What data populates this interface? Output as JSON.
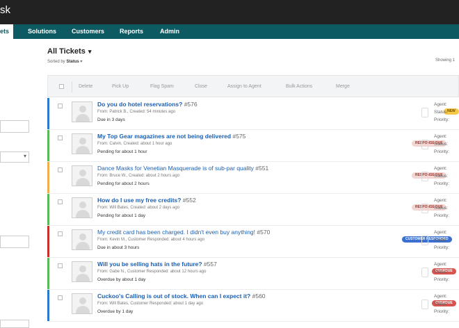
{
  "app": {
    "brand": "sk"
  },
  "nav": {
    "items": [
      {
        "label": "ets",
        "active": true
      },
      {
        "label": "Solutions"
      },
      {
        "label": "Customers"
      },
      {
        "label": "Reports"
      },
      {
        "label": "Admin"
      }
    ]
  },
  "header": {
    "title": "All Tickets",
    "sorted_prefix": "Sorted by",
    "sorted_value": "Status",
    "showing": "Showing 1"
  },
  "toolbar": {
    "buttons": [
      "Delete",
      "Pick Up",
      "Flag Spam",
      "Close",
      "Assign to Agent",
      "Bulk Actions",
      "Merge"
    ]
  },
  "detail_labels": {
    "agent": "Agent:",
    "status": "Status:",
    "priority": "Priority:"
  },
  "tickets": [
    {
      "subject": "Do you do hotel reservations?",
      "number": "#576",
      "meta": "From: Patrick B., Created: 54 minutes ago",
      "status": "Due in 3 days",
      "badge": "NEW",
      "badge_type": "new",
      "stripe": "#2a7ac9",
      "bold": true
    },
    {
      "subject": "My Top Gear magazines are not being delivered",
      "number": "#575",
      "meta": "From: Calvin, Created: about 1 hour ago",
      "status": "Pending for about 1 hour",
      "badge": "RESPONSE DUE",
      "badge_type": "resp",
      "stripe": "#5cb85c",
      "bold": true
    },
    {
      "subject": "Dance Masks for Venetian Masquerade is of sub-par quality",
      "number": "#551",
      "meta": "From: Bruce W., Created: about 2 hours ago",
      "status": "Pending for about 2 hours",
      "badge": "RESPONSE DUE",
      "badge_type": "resp",
      "stripe": "#f0ad4e",
      "bold": false
    },
    {
      "subject": "How do I use my free credits?",
      "number": "#552",
      "meta": "From: Will Bates, Created: about 2 days ago",
      "status": "Pending for about 1 day",
      "badge": "RESPONSE DUE",
      "badge_type": "resp",
      "stripe": "#5cb85c",
      "bold": true
    },
    {
      "subject": "My credit card has been charged. I didn't even buy anything!",
      "number": "#570",
      "meta": "From: Kevin M., Customer Responded: about 4 hours ago",
      "status": "Due in about 3 hours",
      "badge": "CUSTOMER RESPONDED",
      "badge_type": "cust",
      "stripe": "#c9302c",
      "bold": false
    },
    {
      "subject": "Will you be selling hats in the future?",
      "number": "#557",
      "meta": "From: Gabe N., Customer Responded: about 12 hours ago",
      "status": "Overdue by about 1 day",
      "badge": "OVERDUE",
      "badge_type": "over",
      "stripe": "#5cb85c",
      "bold": true
    },
    {
      "subject": "Cuckoo's Calling is out of stock. When can I expect it?",
      "number": "#560",
      "meta": "From: Will Bates, Customer Responded: about 1 day ago",
      "status": "Overdue by 1 day",
      "badge": "OVERDUE",
      "badge_type": "over",
      "stripe": "#2a7ac9",
      "bold": true
    }
  ]
}
